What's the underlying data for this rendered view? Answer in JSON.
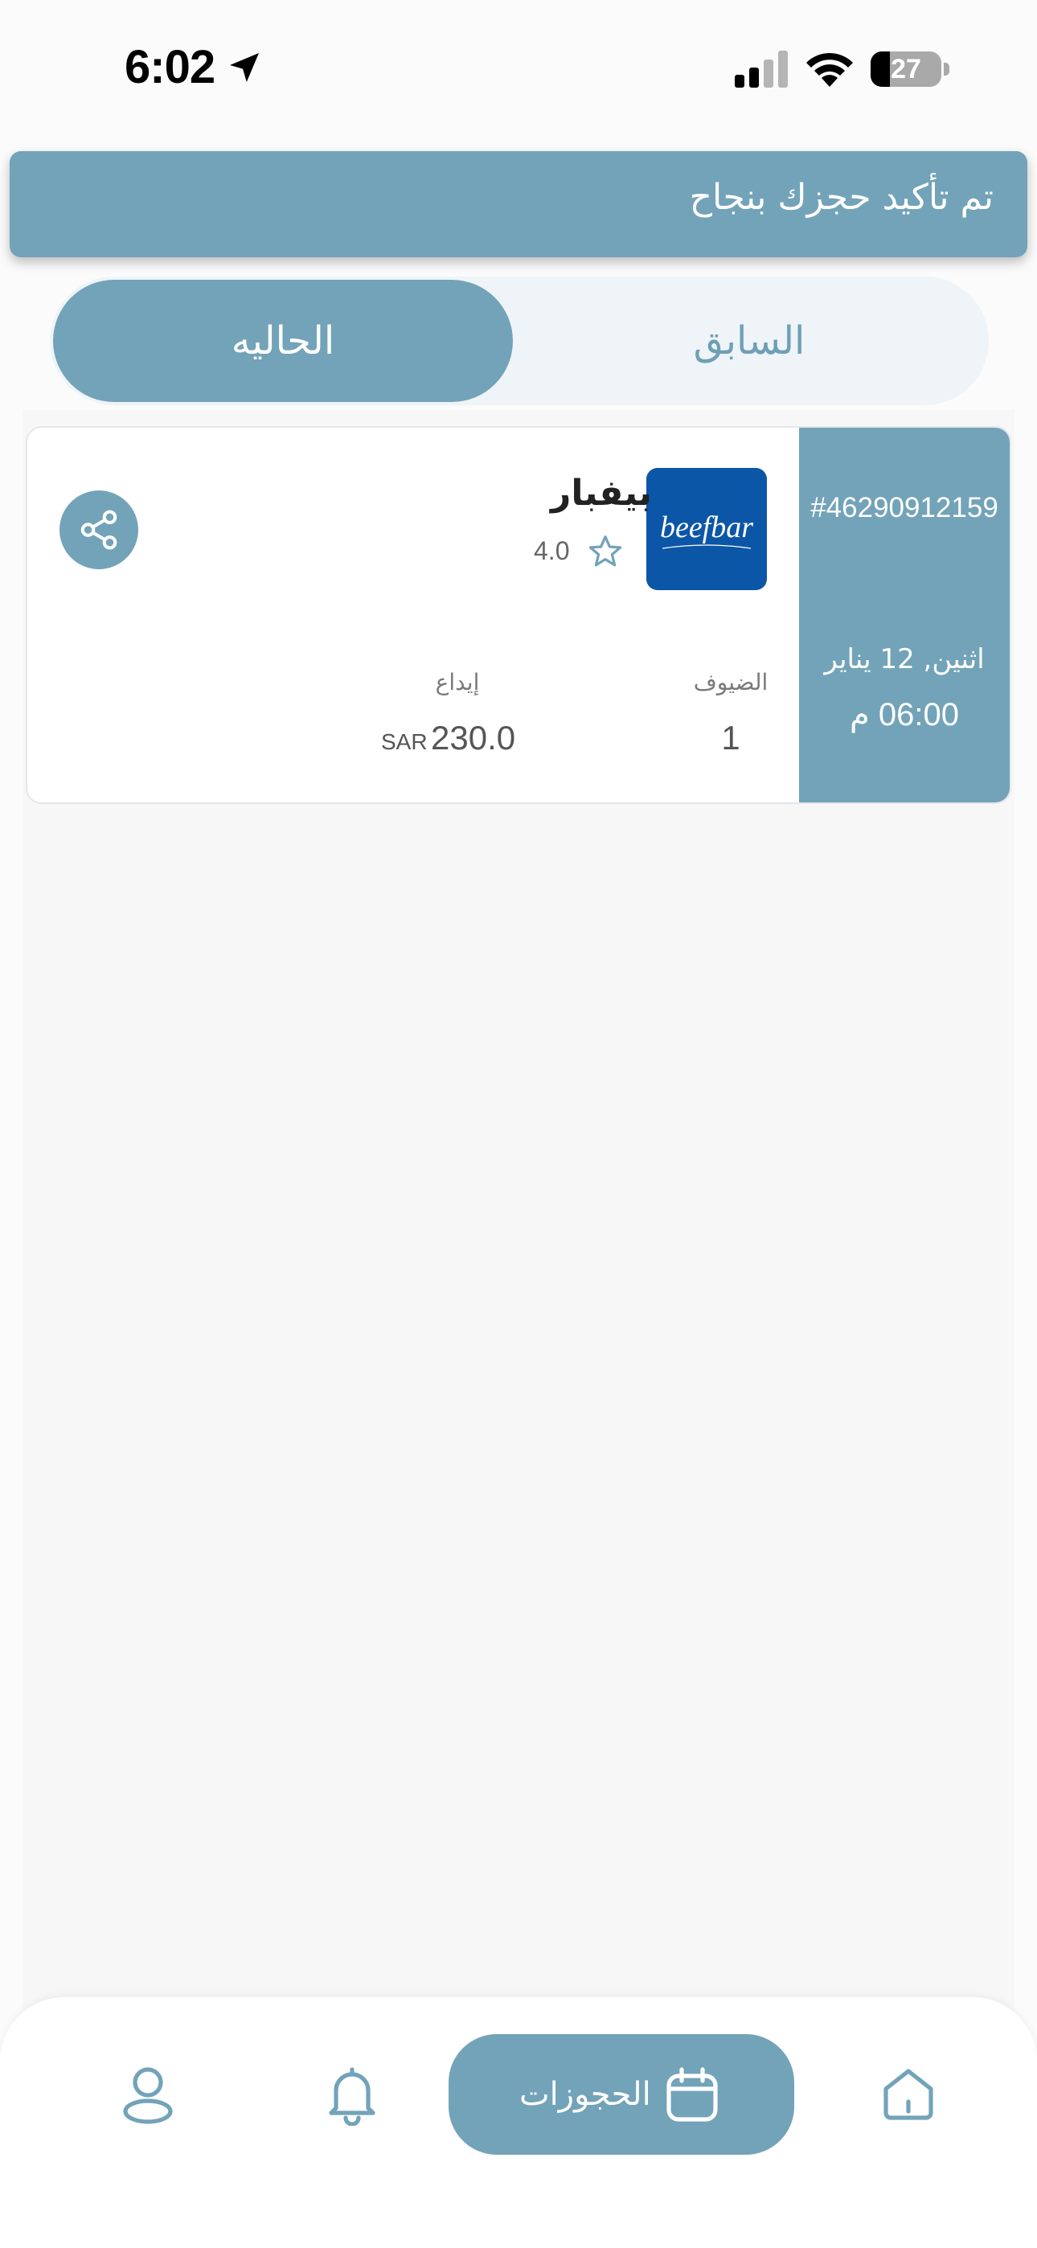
{
  "status_bar": {
    "time": "6:02",
    "battery_level": "27",
    "battery_fraction": 0.27,
    "icons": [
      "location-arrow-icon",
      "cellular-signal-icon",
      "wifi-icon",
      "battery-icon"
    ]
  },
  "toast": {
    "message": "تم تأكيد حجزك بنجاح"
  },
  "tabs": {
    "current": "الحاليه",
    "past": "السابق",
    "selected": "current"
  },
  "booking": {
    "number": "#46290912159",
    "date": "اثنين, 12 يناير",
    "time": "06:00 م",
    "restaurant": {
      "name": "بيفبار",
      "logo_text": "beefbar",
      "rating": "4.0"
    },
    "guests_label": "الضيوف",
    "guests_value": "1",
    "deposit_label": "إيداع",
    "deposit_value": "230.0",
    "deposit_currency": "SAR"
  },
  "bottom_nav": {
    "bookings_label": "الحجوزات",
    "items": [
      "profile-icon",
      "bell-icon",
      "calendar-icon",
      "home-icon"
    ]
  },
  "colors": {
    "accent": "#72a3b9",
    "accent_light": "#eef4f7",
    "logo_blue": "#0c56a7"
  }
}
